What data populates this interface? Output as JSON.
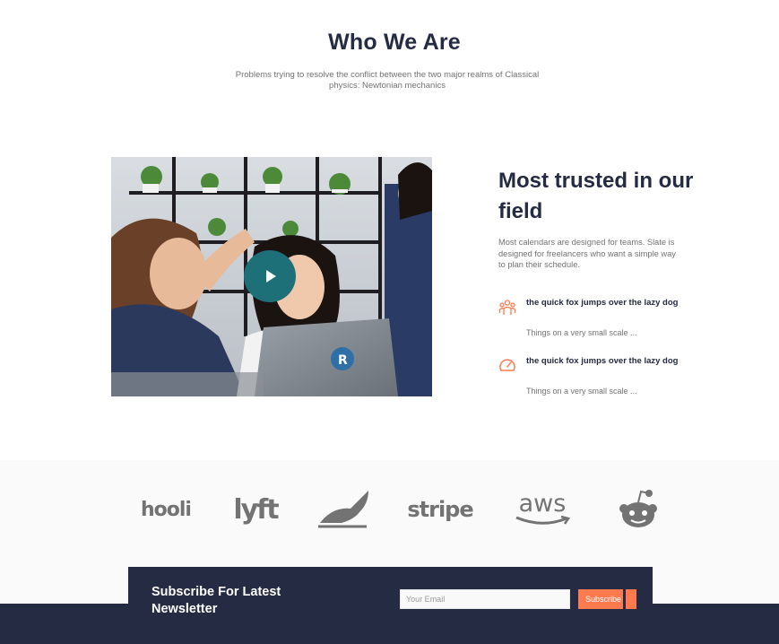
{
  "hero": {
    "title": "Who We Are",
    "subtitle": "Problems trying to resolve the conflict between the two major realms of Classical physics: Newtonian mechanics"
  },
  "video": {
    "play_icon": "play-icon"
  },
  "trusted": {
    "title": "Most trusted in our field",
    "description": "Most calendars are designed for teams. Slate is designed for freelancers who want a simple way to plan their schedule."
  },
  "features": [
    {
      "icon": "team-icon",
      "title": "the quick fox jumps over the lazy dog",
      "subtitle": "Things on a very small scale ..."
    },
    {
      "icon": "speedometer-icon",
      "title": "the quick fox jumps over the lazy dog",
      "subtitle": "Things on a very small scale ..."
    }
  ],
  "logos": [
    {
      "name": "hooli",
      "label": "hooli"
    },
    {
      "name": "lyft",
      "label": "lyft"
    },
    {
      "name": "piedpiper",
      "label": ""
    },
    {
      "name": "stripe",
      "label": "stripe"
    },
    {
      "name": "aws",
      "label": "aws"
    },
    {
      "name": "reddit",
      "label": ""
    }
  ],
  "newsletter": {
    "title": "Subscribe For Latest Newsletter",
    "email_placeholder": "Your Email",
    "button_label": "Subscribe"
  },
  "colors": {
    "navy": "#252b42",
    "accent": "#ff7b4f",
    "teal": "#1d6f78",
    "text_muted": "#737373"
  }
}
